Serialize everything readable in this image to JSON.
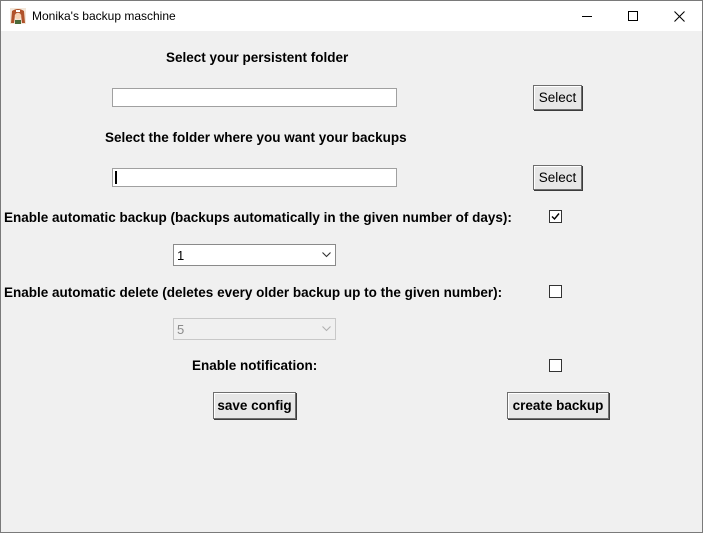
{
  "window": {
    "title": "Monika's backup maschine",
    "icon": "anime-character-icon",
    "controls": [
      "minimize-icon",
      "maximize-icon",
      "close-icon"
    ]
  },
  "persistent": {
    "label": "Select your persistent folder",
    "value": "",
    "button": "Select"
  },
  "backup_folder": {
    "label": "Select the folder where you want your backups",
    "value": "",
    "button": "Select"
  },
  "auto_backup": {
    "label": "Enable automatic backup (backups automatically in the given number of days):",
    "checked": true,
    "days": "1"
  },
  "auto_delete": {
    "label": "Enable automatic delete (deletes every older backup up to the given number):",
    "checked": false,
    "count": "5"
  },
  "notification": {
    "label": "Enable notification:",
    "checked": false
  },
  "buttons": {
    "save": "save config",
    "create": "create backup"
  }
}
